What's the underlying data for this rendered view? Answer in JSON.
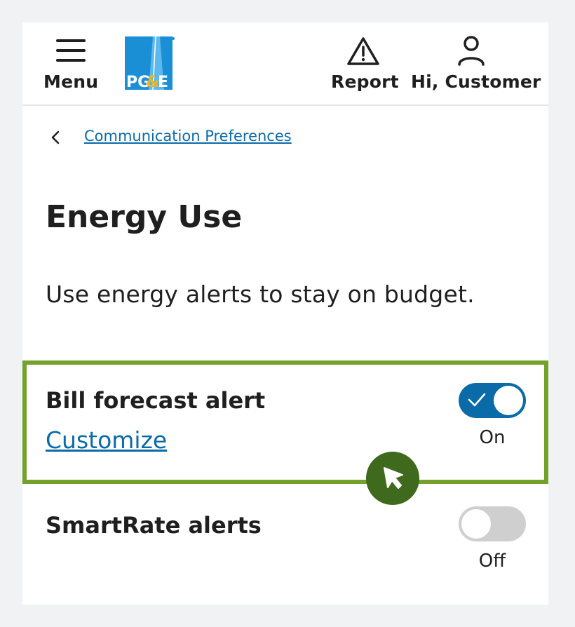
{
  "header": {
    "menu_label": "Menu",
    "logo_text": "PG&E",
    "report_label": "Report",
    "account_label": "Hi, Customer"
  },
  "breadcrumb": {
    "link_text": "Communication Preferences"
  },
  "page": {
    "title": "Energy Use",
    "description": "Use energy alerts to stay on budget."
  },
  "alerts": [
    {
      "title": "Bill forecast alert",
      "link": "Customize",
      "state": "On",
      "enabled": true
    },
    {
      "title": "SmartRate alerts",
      "state": "Off",
      "enabled": false
    }
  ],
  "colors": {
    "accent": "#0a6ba8",
    "highlight": "#73a12b",
    "cursor_badge": "#3f6a1e",
    "toggle_off": "#cfcfcf",
    "logo_blue": "#1a8fd6",
    "logo_gold": "#f7b512"
  },
  "icons": [
    "hamburger-icon",
    "pge-logo",
    "warning-icon",
    "user-icon",
    "chevron-left-icon",
    "check-icon",
    "cursor-icon"
  ]
}
